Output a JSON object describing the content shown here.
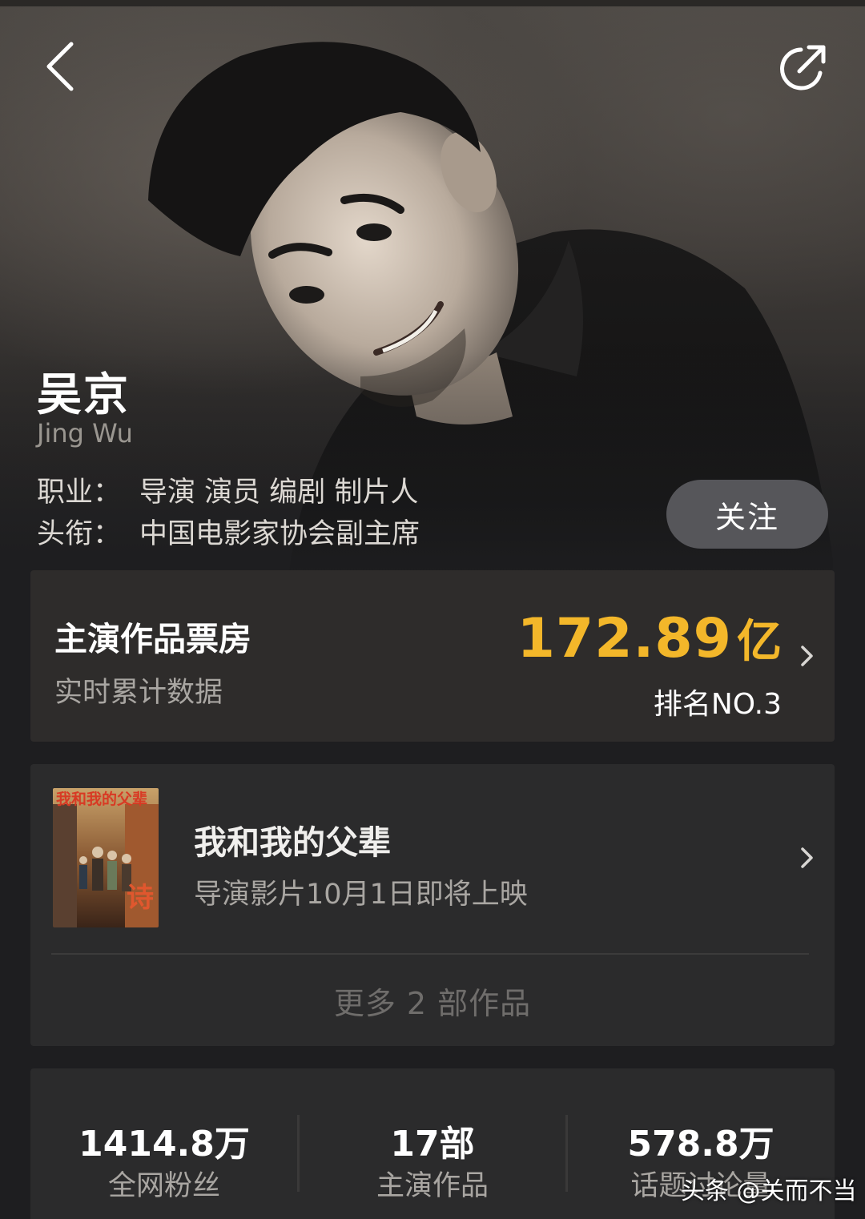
{
  "person": {
    "name": "吴京",
    "name_en": "Jing Wu",
    "occupation_label": "职业：",
    "occupation": "导演 演员 编剧 制片人",
    "title_label": "头衔：",
    "title": "中国电影家协会副主席"
  },
  "actions": {
    "follow_label": "关注"
  },
  "box_office": {
    "title": "主演作品票房",
    "subtitle": "实时累计数据",
    "value": "172.89",
    "unit": "亿",
    "rank": "排名NO.3"
  },
  "works": {
    "movie_title": "我和我的父辈",
    "movie_subtitle": "导演影片10月1日即将上映",
    "more_label": "更多 2 部作品",
    "poster_text": "我和我的父辈"
  },
  "stats": [
    {
      "value": "1414.8万",
      "label": "全网粉丝"
    },
    {
      "value": "17部",
      "label": "主演作品"
    },
    {
      "value": "578.8万",
      "label": "话题讨论量"
    }
  ],
  "watermark": "头条 @关而不当",
  "colors": {
    "accent": "#f3b72a",
    "background": "#1e1e20",
    "card": "#2c2b2b"
  },
  "icons": {
    "back": "back-arrow-icon",
    "share": "share-icon",
    "chevron": "chevron-right-icon"
  }
}
